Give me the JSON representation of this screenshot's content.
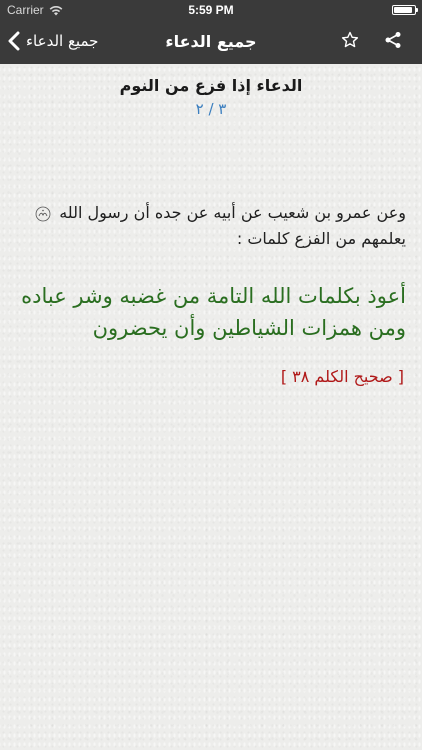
{
  "status_bar": {
    "carrier": "Carrier",
    "time": "5:59 PM",
    "battery_level": 0.9
  },
  "nav": {
    "back_label": "جميع الدعاء",
    "title": "جميع الدعاء",
    "star_icon": "star-icon",
    "share_icon": "share-icon",
    "back_icon": "chevron-left-icon"
  },
  "dua": {
    "title": "الدعاء إذا فزع من النوم",
    "counter": "٣ / ٢",
    "narration_part1": "وعن عمرو بن شعيب عن أبيه عن جده أن رسول الله",
    "narration_part2": "يعلمهم من الفزع كلمات :",
    "text": "أعوذ بكلمات الله التامة من غضبه وشر عباده ومن همزات الشياطين وأن يحضرون",
    "source": "[ صحيح الكلم ٣٨ ]"
  },
  "colors": {
    "bar": "#3a3a3a",
    "dua_text": "#2a6e20",
    "source": "#b01818",
    "counter": "#3c7fbf"
  }
}
